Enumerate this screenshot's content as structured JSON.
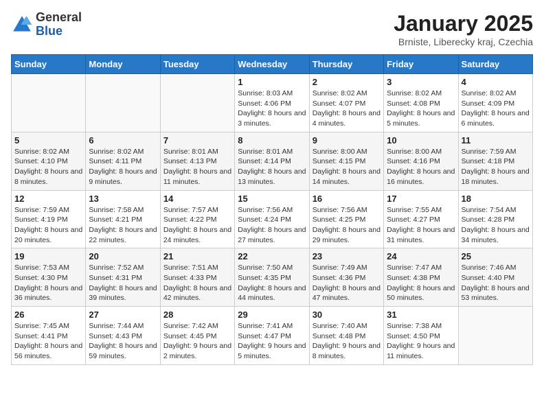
{
  "header": {
    "logo_general": "General",
    "logo_blue": "Blue",
    "title": "January 2025",
    "subtitle": "Brniste, Liberecky kraj, Czechia"
  },
  "weekdays": [
    "Sunday",
    "Monday",
    "Tuesday",
    "Wednesday",
    "Thursday",
    "Friday",
    "Saturday"
  ],
  "weeks": [
    [
      {
        "day": "",
        "sunrise": "",
        "sunset": "",
        "daylight": ""
      },
      {
        "day": "",
        "sunrise": "",
        "sunset": "",
        "daylight": ""
      },
      {
        "day": "",
        "sunrise": "",
        "sunset": "",
        "daylight": ""
      },
      {
        "day": "1",
        "sunrise": "Sunrise: 8:03 AM",
        "sunset": "Sunset: 4:06 PM",
        "daylight": "Daylight: 8 hours and 3 minutes."
      },
      {
        "day": "2",
        "sunrise": "Sunrise: 8:02 AM",
        "sunset": "Sunset: 4:07 PM",
        "daylight": "Daylight: 8 hours and 4 minutes."
      },
      {
        "day": "3",
        "sunrise": "Sunrise: 8:02 AM",
        "sunset": "Sunset: 4:08 PM",
        "daylight": "Daylight: 8 hours and 5 minutes."
      },
      {
        "day": "4",
        "sunrise": "Sunrise: 8:02 AM",
        "sunset": "Sunset: 4:09 PM",
        "daylight": "Daylight: 8 hours and 6 minutes."
      }
    ],
    [
      {
        "day": "5",
        "sunrise": "Sunrise: 8:02 AM",
        "sunset": "Sunset: 4:10 PM",
        "daylight": "Daylight: 8 hours and 8 minutes."
      },
      {
        "day": "6",
        "sunrise": "Sunrise: 8:02 AM",
        "sunset": "Sunset: 4:11 PM",
        "daylight": "Daylight: 8 hours and 9 minutes."
      },
      {
        "day": "7",
        "sunrise": "Sunrise: 8:01 AM",
        "sunset": "Sunset: 4:13 PM",
        "daylight": "Daylight: 8 hours and 11 minutes."
      },
      {
        "day": "8",
        "sunrise": "Sunrise: 8:01 AM",
        "sunset": "Sunset: 4:14 PM",
        "daylight": "Daylight: 8 hours and 13 minutes."
      },
      {
        "day": "9",
        "sunrise": "Sunrise: 8:00 AM",
        "sunset": "Sunset: 4:15 PM",
        "daylight": "Daylight: 8 hours and 14 minutes."
      },
      {
        "day": "10",
        "sunrise": "Sunrise: 8:00 AM",
        "sunset": "Sunset: 4:16 PM",
        "daylight": "Daylight: 8 hours and 16 minutes."
      },
      {
        "day": "11",
        "sunrise": "Sunrise: 7:59 AM",
        "sunset": "Sunset: 4:18 PM",
        "daylight": "Daylight: 8 hours and 18 minutes."
      }
    ],
    [
      {
        "day": "12",
        "sunrise": "Sunrise: 7:59 AM",
        "sunset": "Sunset: 4:19 PM",
        "daylight": "Daylight: 8 hours and 20 minutes."
      },
      {
        "day": "13",
        "sunrise": "Sunrise: 7:58 AM",
        "sunset": "Sunset: 4:21 PM",
        "daylight": "Daylight: 8 hours and 22 minutes."
      },
      {
        "day": "14",
        "sunrise": "Sunrise: 7:57 AM",
        "sunset": "Sunset: 4:22 PM",
        "daylight": "Daylight: 8 hours and 24 minutes."
      },
      {
        "day": "15",
        "sunrise": "Sunrise: 7:56 AM",
        "sunset": "Sunset: 4:24 PM",
        "daylight": "Daylight: 8 hours and 27 minutes."
      },
      {
        "day": "16",
        "sunrise": "Sunrise: 7:56 AM",
        "sunset": "Sunset: 4:25 PM",
        "daylight": "Daylight: 8 hours and 29 minutes."
      },
      {
        "day": "17",
        "sunrise": "Sunrise: 7:55 AM",
        "sunset": "Sunset: 4:27 PM",
        "daylight": "Daylight: 8 hours and 31 minutes."
      },
      {
        "day": "18",
        "sunrise": "Sunrise: 7:54 AM",
        "sunset": "Sunset: 4:28 PM",
        "daylight": "Daylight: 8 hours and 34 minutes."
      }
    ],
    [
      {
        "day": "19",
        "sunrise": "Sunrise: 7:53 AM",
        "sunset": "Sunset: 4:30 PM",
        "daylight": "Daylight: 8 hours and 36 minutes."
      },
      {
        "day": "20",
        "sunrise": "Sunrise: 7:52 AM",
        "sunset": "Sunset: 4:31 PM",
        "daylight": "Daylight: 8 hours and 39 minutes."
      },
      {
        "day": "21",
        "sunrise": "Sunrise: 7:51 AM",
        "sunset": "Sunset: 4:33 PM",
        "daylight": "Daylight: 8 hours and 42 minutes."
      },
      {
        "day": "22",
        "sunrise": "Sunrise: 7:50 AM",
        "sunset": "Sunset: 4:35 PM",
        "daylight": "Daylight: 8 hours and 44 minutes."
      },
      {
        "day": "23",
        "sunrise": "Sunrise: 7:49 AM",
        "sunset": "Sunset: 4:36 PM",
        "daylight": "Daylight: 8 hours and 47 minutes."
      },
      {
        "day": "24",
        "sunrise": "Sunrise: 7:47 AM",
        "sunset": "Sunset: 4:38 PM",
        "daylight": "Daylight: 8 hours and 50 minutes."
      },
      {
        "day": "25",
        "sunrise": "Sunrise: 7:46 AM",
        "sunset": "Sunset: 4:40 PM",
        "daylight": "Daylight: 8 hours and 53 minutes."
      }
    ],
    [
      {
        "day": "26",
        "sunrise": "Sunrise: 7:45 AM",
        "sunset": "Sunset: 4:41 PM",
        "daylight": "Daylight: 8 hours and 56 minutes."
      },
      {
        "day": "27",
        "sunrise": "Sunrise: 7:44 AM",
        "sunset": "Sunset: 4:43 PM",
        "daylight": "Daylight: 8 hours and 59 minutes."
      },
      {
        "day": "28",
        "sunrise": "Sunrise: 7:42 AM",
        "sunset": "Sunset: 4:45 PM",
        "daylight": "Daylight: 9 hours and 2 minutes."
      },
      {
        "day": "29",
        "sunrise": "Sunrise: 7:41 AM",
        "sunset": "Sunset: 4:47 PM",
        "daylight": "Daylight: 9 hours and 5 minutes."
      },
      {
        "day": "30",
        "sunrise": "Sunrise: 7:40 AM",
        "sunset": "Sunset: 4:48 PM",
        "daylight": "Daylight: 9 hours and 8 minutes."
      },
      {
        "day": "31",
        "sunrise": "Sunrise: 7:38 AM",
        "sunset": "Sunset: 4:50 PM",
        "daylight": "Daylight: 9 hours and 11 minutes."
      },
      {
        "day": "",
        "sunrise": "",
        "sunset": "",
        "daylight": ""
      }
    ]
  ]
}
